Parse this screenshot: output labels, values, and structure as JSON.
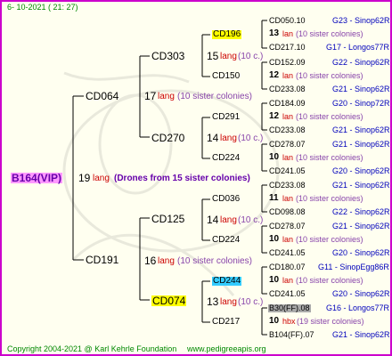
{
  "header": {
    "date": "6- 10-2021 ( 21: 27)"
  },
  "footer": {
    "copyright": "Copyright 2004-2021 @ Karl Kehrle Foundation",
    "website": "www.pedigreeapis.org"
  },
  "root": {
    "id": "B164(VIP)",
    "num": "19",
    "lang": "lang",
    "desc": "(Drones from 15 sister colonies)"
  },
  "gen1": [
    {
      "id": "CD064",
      "num": "17",
      "lang": "lang",
      "desc": "(10 sister colonies)"
    },
    {
      "id": "CD191",
      "num": "16",
      "lang": "lang",
      "desc": "(10 sister colonies)"
    }
  ],
  "gen2": [
    {
      "id": "CD303",
      "num": "15",
      "lang": "lang",
      "desc": "(10 c.)"
    },
    {
      "id": "CD270",
      "num": "14",
      "lang": "lang",
      "desc": "(10 c.)"
    },
    {
      "id": "CD125",
      "num": "14",
      "lang": "lang",
      "desc": "(10 c.)"
    },
    {
      "id": "CD074",
      "num": "13",
      "lang": "lang",
      "desc": "(10 c.)"
    }
  ],
  "gen3": [
    "CD196",
    "CD150",
    "CD291",
    "CD224",
    "CD036",
    "CD224",
    "CD244",
    "CD217"
  ],
  "gen4": [
    {
      "mother": {
        "id": "CD050.10",
        "info": "G23 - Sinop62R"
      },
      "num": "13",
      "lang": "lan",
      "desc": "(10 sister colonies)",
      "father": {
        "id": "CD217.10",
        "info": "G17 - Longos77R"
      }
    },
    {
      "mother": {
        "id": "CD152.09",
        "info": "G22 - Sinop62R"
      },
      "num": "12",
      "lang": "lan",
      "desc": "(10 sister colonies)",
      "father": {
        "id": "CD233.08",
        "info": "G21 - Sinop62R"
      }
    },
    {
      "mother": {
        "id": "CD184.09",
        "info": "G20 - Sinop72R"
      },
      "num": "12",
      "lang": "lan",
      "desc": "(10 sister colonies)",
      "father": {
        "id": "CD233.08",
        "info": "G21 - Sinop62R"
      }
    },
    {
      "mother": {
        "id": "CD278.07",
        "info": "G21 - Sinop62R"
      },
      "num": "10",
      "lang": "lan",
      "desc": "(10 sister colonies)",
      "father": {
        "id": "CD241.05",
        "info": "G20 - Sinop62R"
      }
    },
    {
      "mother": {
        "id": "CD233.08",
        "info": "G21 - Sinop62R"
      },
      "num": "11",
      "lang": "lan",
      "desc": "(10 sister colonies)",
      "father": {
        "id": "CD098.08",
        "info": "G22 - Sinop62R"
      }
    },
    {
      "mother": {
        "id": "CD278.07",
        "info": "G21 - Sinop62R"
      },
      "num": "10",
      "lang": "lan",
      "desc": "(10 sister colonies)",
      "father": {
        "id": "CD241.05",
        "info": "G20 - Sinop62R"
      }
    },
    {
      "mother": {
        "id": "CD180.07",
        "info": "G11 - SinopEgg86R"
      },
      "num": "10",
      "lang": "lan",
      "desc": "(10 sister colonies)",
      "father": {
        "id": "CD241.05",
        "info": "G20 - Sinop62R"
      }
    },
    {
      "mother": {
        "id": "B30(FF).08",
        "info": "G16 - Longos77R"
      },
      "num": "10",
      "lang": "hbx",
      "desc": "(19 sister colonies)",
      "father": {
        "id": "B104(FF).07",
        "info": "G21 - Sinop62R"
      }
    }
  ],
  "colors": {
    "border": "#cc00cc",
    "highlight_yellow": "#ffff00",
    "highlight_cyan": "#33ccff",
    "highlight_gray": "#aaaaaa",
    "highlight_pink": "#ff99ff"
  }
}
